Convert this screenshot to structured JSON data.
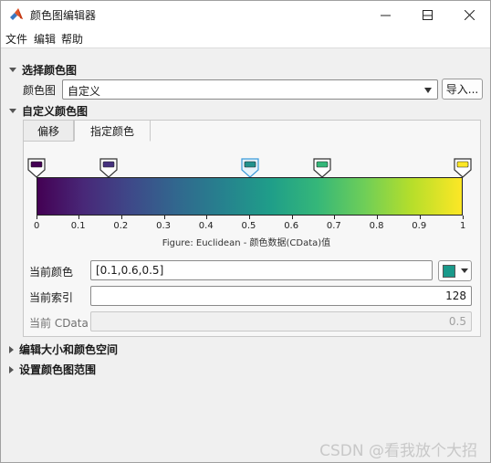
{
  "window": {
    "title": "颜色图编辑器"
  },
  "menu": [
    "文件",
    "编辑",
    "帮助"
  ],
  "section_select": {
    "heading": "选择颜色图",
    "colormap_label": "颜色图",
    "colormap_value": "自定义",
    "import_button": "导入..."
  },
  "section_custom": {
    "heading": "自定义颜色图",
    "tabs": [
      "偏移",
      "指定颜色"
    ],
    "active_tab": "指定颜色",
    "colorbar_ticks": [
      "0",
      "0.1",
      "0.2",
      "0.3",
      "0.4",
      "0.5",
      "0.6",
      "0.7",
      "0.8",
      "0.9",
      "1"
    ],
    "markers": [
      {
        "position": 0.0,
        "color": "#440154"
      },
      {
        "position": 0.17,
        "color": "#46327e"
      },
      {
        "position": 0.5,
        "color": "#21918c"
      },
      {
        "position": 0.67,
        "color": "#35b779"
      },
      {
        "position": 1.0,
        "color": "#fde725"
      }
    ],
    "selected_marker": 2,
    "caption": "Figure: Euclidean - 颜色数据(CData)值",
    "current_color_label": "当前颜色",
    "current_color_value": "[0.1,0.6,0.5]",
    "current_color_swatch": "#1a998a",
    "current_index_label": "当前索引",
    "current_index_value": "128",
    "current_cdata_label": "当前 CData",
    "current_cdata_value": "0.5"
  },
  "collapsed_sections": [
    "编辑大小和颜色空间",
    "设置颜色图范围"
  ],
  "watermark": "CSDN @看我放个大招"
}
